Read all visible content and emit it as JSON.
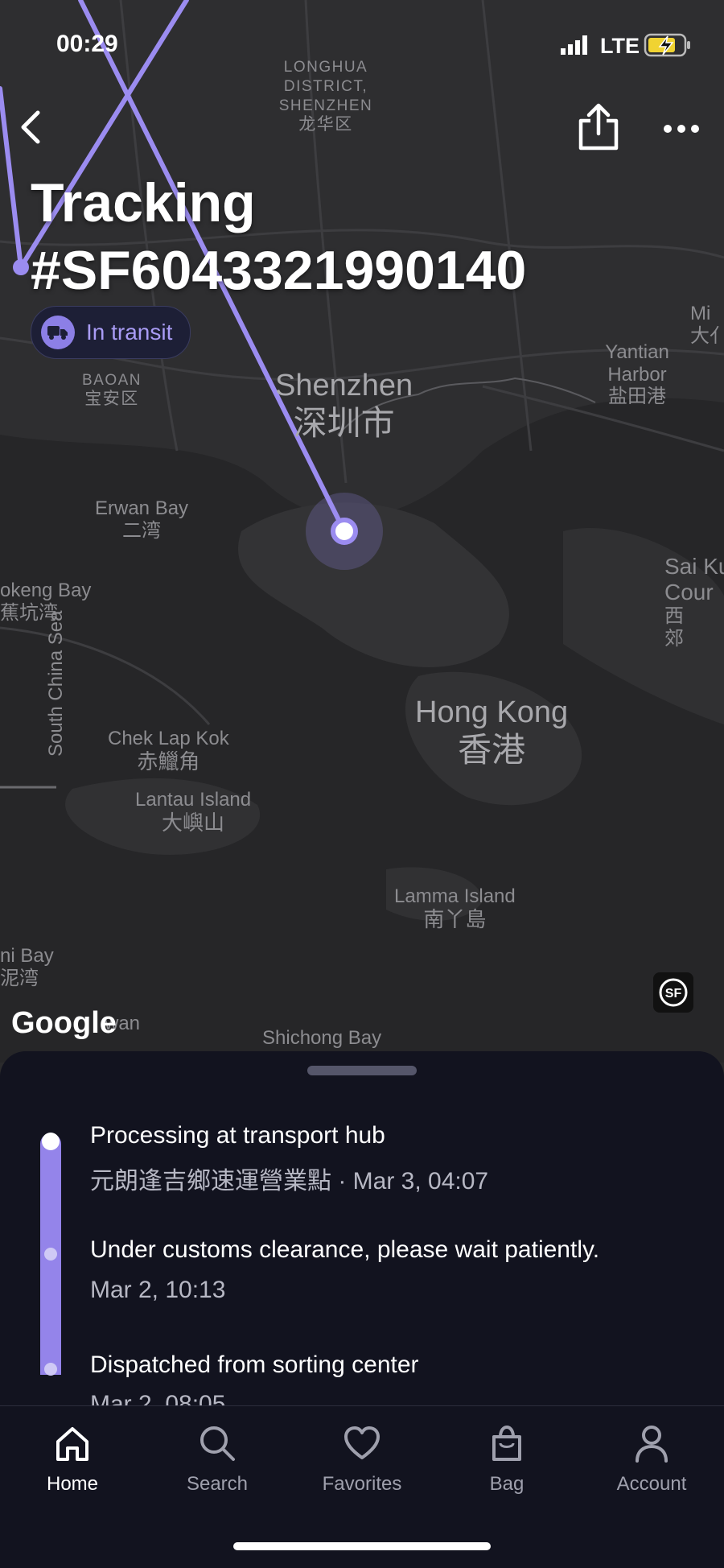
{
  "status_bar": {
    "time": "00:29",
    "network": "LTE"
  },
  "header": {
    "back_icon": "chevron-left-icon",
    "share_icon": "share-icon",
    "more_icon": "more-dots-icon",
    "title_line1": "Tracking",
    "title_line2": "#SF6043321990140",
    "status_pill": "In transit"
  },
  "map": {
    "labels": {
      "longhua": "LONGHUA DISTRICT, SHENZHEN",
      "longhua_zh": "龙华区",
      "baoan": "BAOAN",
      "baoan_zh": "宝安区",
      "shenzhen": "Shenzhen",
      "shenzhen_zh": "深圳市",
      "yantian": "Yantian Harbor",
      "yantian_zh": "盐田港",
      "erwan": "Erwan Bay",
      "erwan_zh": "二湾",
      "houhai": "okeng Bay",
      "houhai_zh": "蕉坑湾",
      "sea": "South China Sea",
      "saikung": "Sai Ku",
      "saikung2": "Cour",
      "saikung_zh": "西",
      "saikung_zh2": "郊",
      "hongkong": "Hong Kong",
      "hongkong_zh": "香港",
      "cheklapkok": "Chek Lap Kok",
      "cheklapkok_zh": "赤鱲角",
      "lantau": "Lantau Island",
      "lantau_zh": "大嶼山",
      "lamma": "Lamma Island",
      "lamma_zh": "南丫島",
      "mirs": "Mi",
      "mirs_zh": "大亻",
      "tailong": "ni Bay",
      "tailong_zh": "泥湾",
      "shuiwan": "wan",
      "shichong": "Shichong Bay",
      "google": "Google"
    },
    "route_color": "#9b8cf0"
  },
  "timeline": [
    {
      "title": "Processing at transport hub",
      "subtitle": "元朗逢吉鄉速運營業點 · Mar 3, 04:07"
    },
    {
      "title": "Under customs clearance, please wait patiently.",
      "subtitle": "Mar 2, 10:13"
    },
    {
      "title": "Dispatched from sorting center",
      "subtitle": "Mar 2, 08:05"
    }
  ],
  "tabs": [
    {
      "label": "Home",
      "icon": "home-icon"
    },
    {
      "label": "Search",
      "icon": "search-icon"
    },
    {
      "label": "Favorites",
      "icon": "heart-icon"
    },
    {
      "label": "Bag",
      "icon": "bag-icon"
    },
    {
      "label": "Account",
      "icon": "account-icon"
    }
  ],
  "colors": {
    "accent": "#9b8cf0",
    "sheet_bg": "#12131f",
    "map_bg": "#2e2e30"
  }
}
